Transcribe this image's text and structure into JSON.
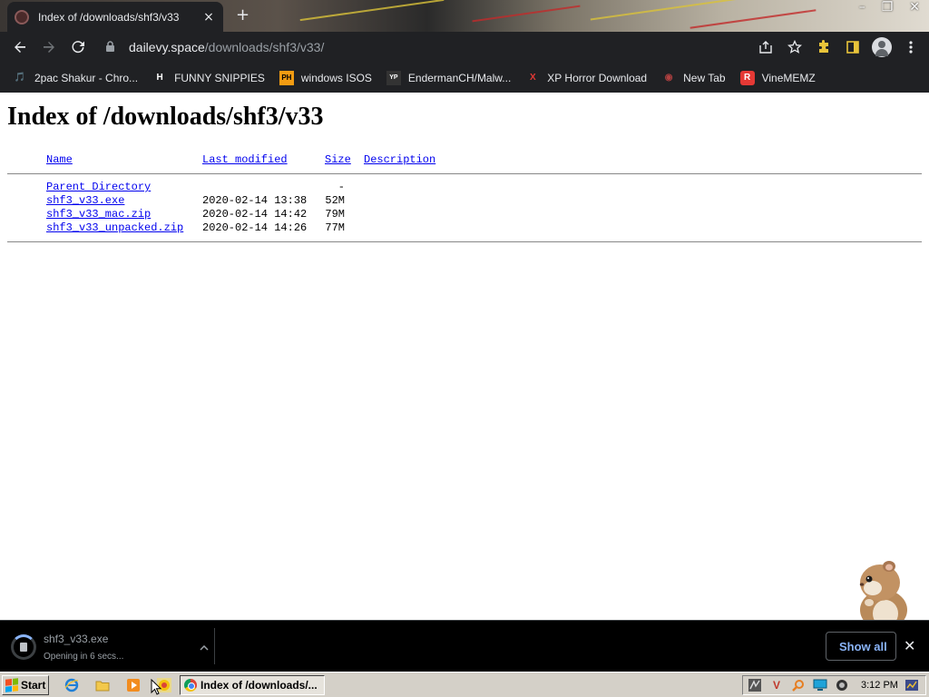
{
  "browser": {
    "tab_title": "Index of /downloads/shf3/v33",
    "tab_close": "×",
    "new_tab": "+",
    "window_controls": [
      "–",
      "❐",
      "✕"
    ],
    "url_host": "dailevy.space",
    "url_path": "/downloads/shf3/v33/",
    "bookmarks": [
      {
        "label": "2pac Shakur - Chro...",
        "icon": "music-icon",
        "icon_text": "🎵",
        "icon_color": "#c0392b"
      },
      {
        "label": "FUNNY SNIPPIES",
        "icon": "h-logo-icon",
        "icon_text": "H",
        "icon_color": "#ffffff"
      },
      {
        "label": "windows ISOS",
        "icon": "ph-logo-icon",
        "icon_text": "PH",
        "icon_color": "#f39c12"
      },
      {
        "label": "EndermanCH/Malw...",
        "icon": "yt-logo-icon",
        "icon_text": "YP",
        "icon_color": "#444444"
      },
      {
        "label": "XP Horror Download",
        "icon": "x-logo-icon",
        "icon_text": "X",
        "icon_color": "#e53935"
      },
      {
        "label": "New Tab",
        "icon": "globe-icon",
        "icon_text": "◉",
        "icon_color": "#b04040"
      },
      {
        "label": "VineMEMZ",
        "icon": "r-logo-icon",
        "icon_text": "R",
        "icon_color": "#e53935"
      }
    ]
  },
  "page": {
    "heading": "Index of /downloads/shf3/v33",
    "columns": {
      "name": "Name",
      "modified": "Last modified",
      "size": "Size",
      "description": "Description"
    },
    "parent": {
      "name": "Parent Directory",
      "size": "-"
    },
    "files": [
      {
        "name": "shf3_v33.exe",
        "modified": "2020-02-14 13:38",
        "size": "52M"
      },
      {
        "name": "shf3_v33_mac.zip",
        "modified": "2020-02-14 14:42",
        "size": "79M"
      },
      {
        "name": "shf3_v33_unpacked.zip",
        "modified": "2020-02-14 14:26",
        "size": "77M"
      }
    ]
  },
  "download_shelf": {
    "file_name": "shf3_v33.exe",
    "status": "Opening in 6 secs...",
    "show_all_label": "Show all",
    "close": "✕"
  },
  "taskbar": {
    "start_label": "Start",
    "active_task": "Index of /downloads/...",
    "clock": "3:12 PM"
  }
}
